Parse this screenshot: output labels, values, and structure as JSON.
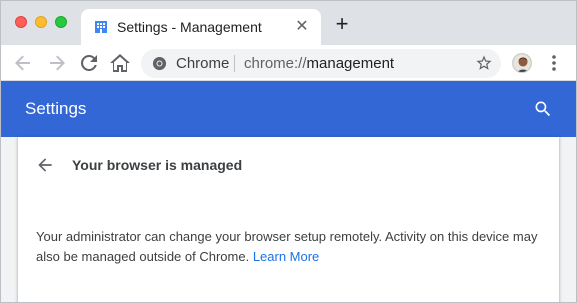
{
  "tab": {
    "title": "Settings - Management",
    "close_glyph": "✕"
  },
  "new_tab_glyph": "+",
  "omnibox": {
    "site_chip": "Chrome",
    "url_scheme": "chrome://",
    "url_host": "management"
  },
  "header": {
    "title": "Settings"
  },
  "card": {
    "title": "Your browser is managed",
    "body": "Your administrator can change your browser setup remotely. Activity on this device may also be managed outside of Chrome.",
    "link_label": "Learn More"
  },
  "colors": {
    "header_blue": "#3367d6",
    "link_blue": "#1a73e8",
    "tab_icon_blue": "#4285f4"
  },
  "icons": [
    "building-icon",
    "close-icon",
    "plus-icon",
    "back-arrow-icon",
    "forward-arrow-icon",
    "reload-icon",
    "home-icon",
    "chrome-logo-icon",
    "star-icon",
    "avatar",
    "more-vert-icon",
    "search-icon"
  ]
}
